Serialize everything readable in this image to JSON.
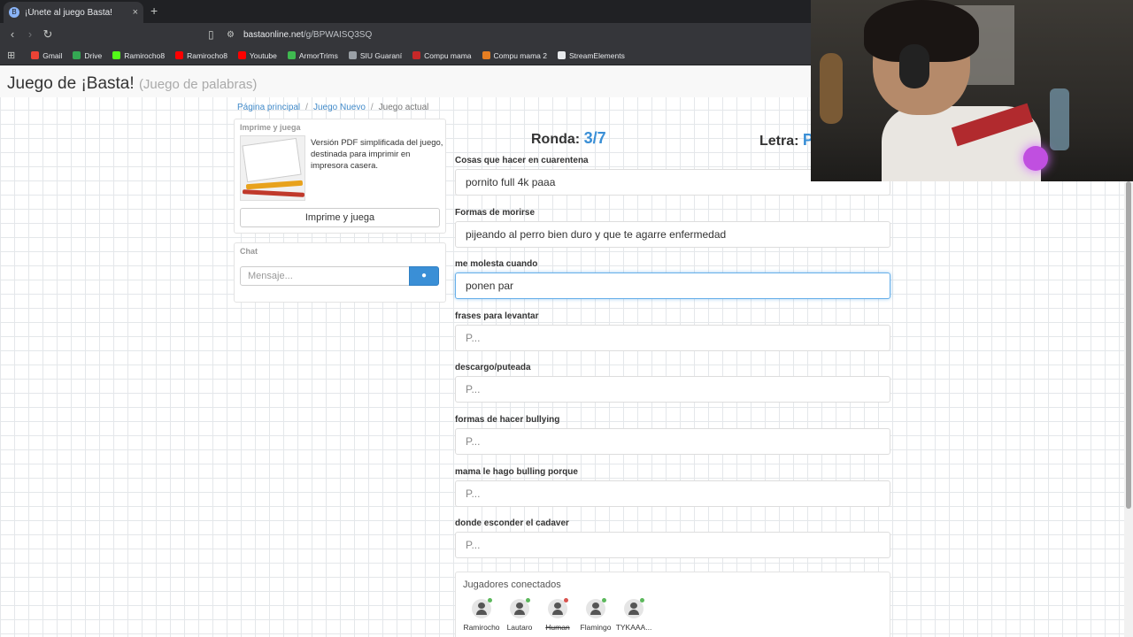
{
  "browser": {
    "tab_title": "¡Únete al juego Basta!",
    "favicon": "B",
    "new_tab_label": "+",
    "close_label": "×",
    "url_host": "bastaonline.net",
    "url_path": "/g/BPWAISQ3SQ",
    "bookmarks": [
      {
        "label": "Gmail",
        "color": "#ea4335"
      },
      {
        "label": "Drive",
        "color": "#34a853"
      },
      {
        "label": "Ramirocho8",
        "color": "#53fc18"
      },
      {
        "label": "Ramirocho8",
        "color": "#ff0000"
      },
      {
        "label": "Youtube",
        "color": "#ff0000"
      },
      {
        "label": "ArmorTrims",
        "color": "#3fb950"
      },
      {
        "label": "SIU Guaraní",
        "color": "#9aa0a6"
      },
      {
        "label": "Compu mama",
        "color": "#c62828"
      },
      {
        "label": "Compu mama 2",
        "color": "#e67e22"
      },
      {
        "label": "StreamElements",
        "color": "#e8eaed"
      }
    ]
  },
  "site": {
    "title": "Juego de ¡Basta!",
    "subtitle": "(Juego de palabras)"
  },
  "breadcrumb": {
    "home": "Página principal",
    "new_game": "Juego Nuevo",
    "current": "Juego actual"
  },
  "print_panel": {
    "heading": "Imprime y juega",
    "description": "Versión PDF simplificada del juego, destinada para imprimir en impresora casera.",
    "button": "Imprime y juega"
  },
  "chat": {
    "heading": "Chat",
    "placeholder": "Mensaje..."
  },
  "game": {
    "round_label": "Ronda:",
    "round_value": "3/7",
    "letter_label": "Letra:",
    "letter_value": "P",
    "categories": [
      {
        "label": "Cosas que hacer en cuarentena",
        "value": "pornito full 4k paaa",
        "placeholder": "P..."
      },
      {
        "label": "Formas de morirse",
        "value": "pijeando al perro bien duro y que te agarre enfermedad",
        "placeholder": "P..."
      },
      {
        "label": "me molesta cuando",
        "value": "ponen par",
        "placeholder": "P..."
      },
      {
        "label": "frases para levantar",
        "value": "",
        "placeholder": "P..."
      },
      {
        "label": "descargo/puteada",
        "value": "",
        "placeholder": "P..."
      },
      {
        "label": "formas de hacer bullying",
        "value": "",
        "placeholder": "P..."
      },
      {
        "label": "mama le hago bulling porque",
        "value": "",
        "placeholder": "P..."
      },
      {
        "label": "donde esconder el cadaver",
        "value": "",
        "placeholder": "P..."
      }
    ]
  },
  "players": {
    "heading": "Jugadores conectados",
    "list": [
      {
        "name": "Ramirocho",
        "status_color": "#5cb85c",
        "struck": false
      },
      {
        "name": "Lautaro",
        "status_color": "#5cb85c",
        "struck": false
      },
      {
        "name": "Human",
        "status_color": "#d9534f",
        "struck": true
      },
      {
        "name": "Flamingo",
        "status_color": "#5cb85c",
        "struck": false
      },
      {
        "name": "TYKAAA...",
        "status_color": "#5cb85c",
        "struck": false
      }
    ]
  },
  "colors": {
    "accent": "#3a8fd6",
    "link": "#428bca"
  }
}
